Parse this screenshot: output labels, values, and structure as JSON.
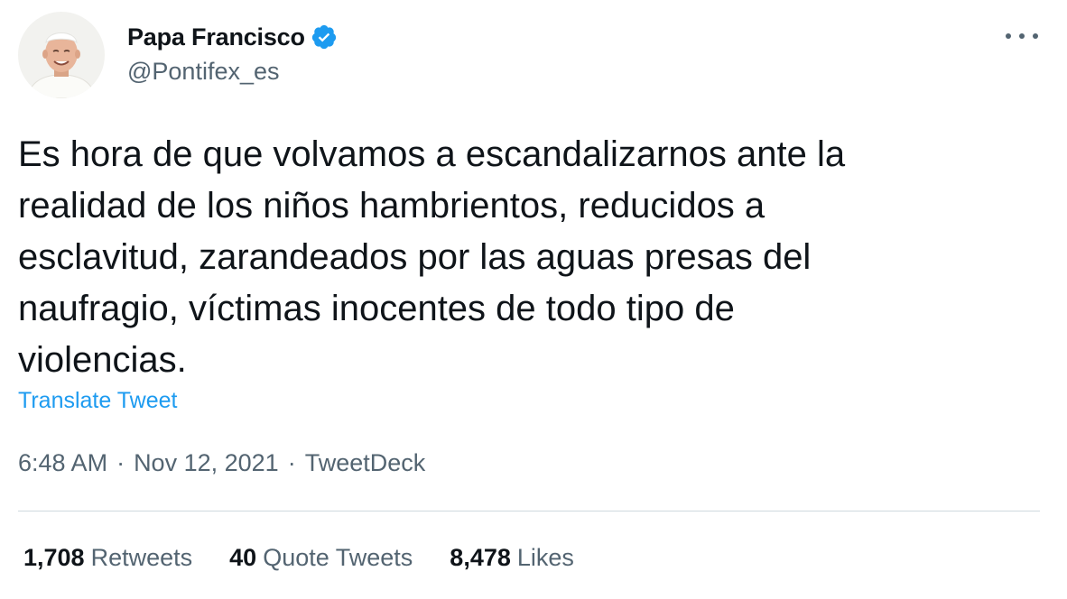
{
  "author": {
    "display_name": "Papa Francisco",
    "handle": "@Pontifex_es",
    "verified": true,
    "avatar_icon": "pope-portrait-avatar"
  },
  "tweet": {
    "text": "Es hora de que volvamos a escandalizarnos ante la\nrealidad de los niños hambrientos, reducidos a\nesclavitud, zarandeados por las aguas presas del\nnaufragio, víctimas inocentes de todo tipo de\nviolencias.",
    "translate_label": "Translate Tweet",
    "time": "6:48 AM",
    "date": "Nov 12, 2021",
    "source": "TweetDeck",
    "separator": "·"
  },
  "stats": {
    "retweets": {
      "count": "1,708",
      "label": "Retweets"
    },
    "quotes": {
      "count": "40",
      "label": "Quote Tweets"
    },
    "likes": {
      "count": "8,478",
      "label": "Likes"
    }
  },
  "colors": {
    "text": "#0f1419",
    "secondary": "#536471",
    "link": "#1d9bf0",
    "verified_badge": "#1d9bf0",
    "divider": "#cfd9de"
  }
}
